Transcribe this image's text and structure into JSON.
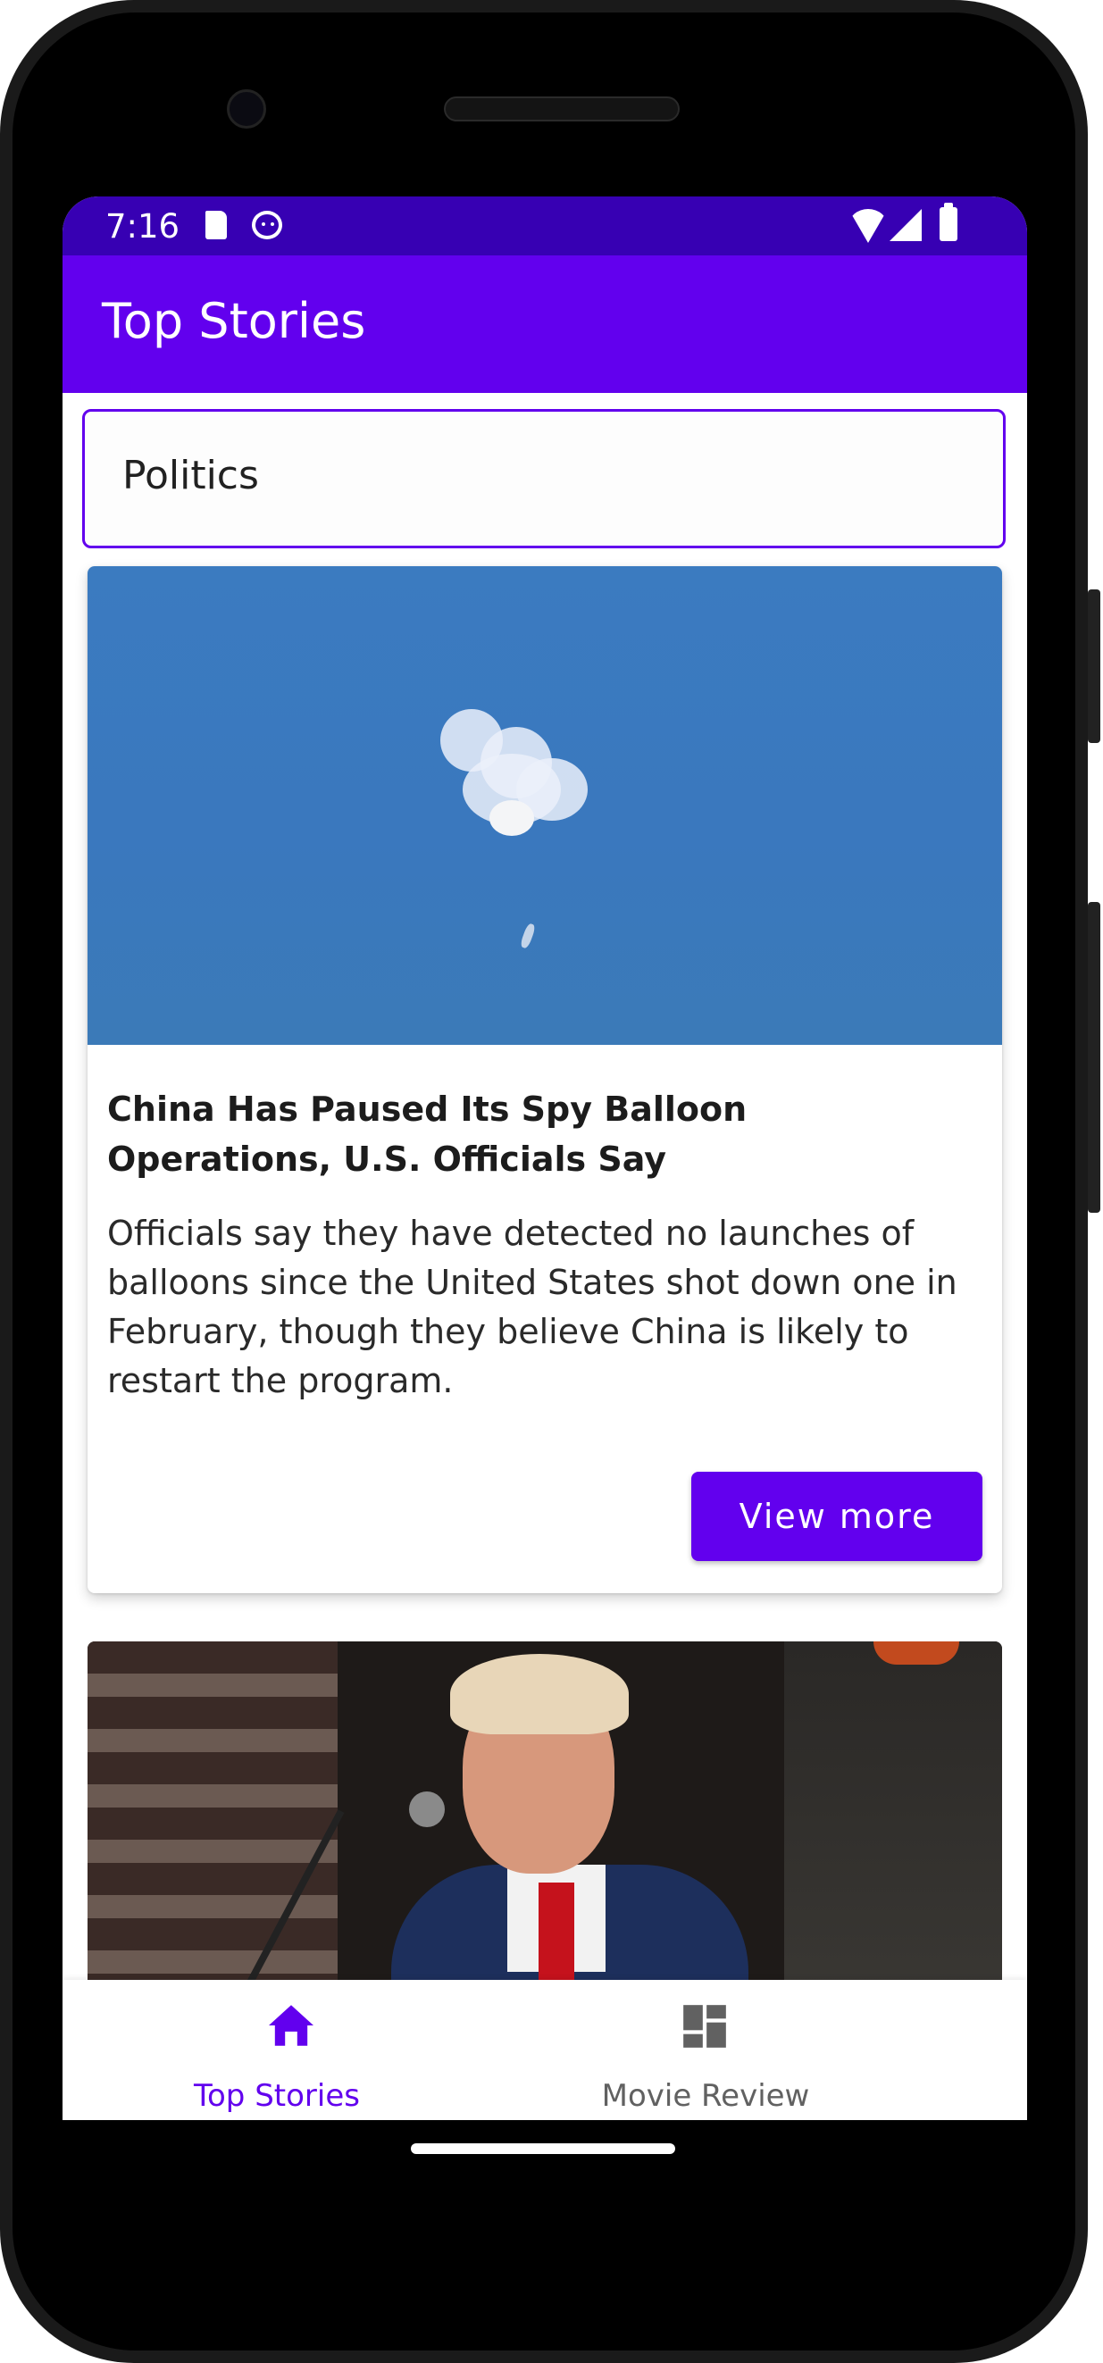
{
  "status_bar": {
    "time": "7:16"
  },
  "app_bar": {
    "title": "Top Stories"
  },
  "category_selector": {
    "value": "Politics"
  },
  "stories": [
    {
      "title": "China Has Paused Its Spy Balloon Operations, U.S. Officials Say",
      "abstract": "Officials say they have detected no launches of balloons since the United States shot down one in February, though they believe China is likely to restart the program.",
      "button_label": "View more"
    }
  ],
  "bottom_nav": {
    "items": [
      {
        "label": "Top Stories",
        "icon": "home-icon",
        "selected": true
      },
      {
        "label": "Movie Review",
        "icon": "dashboard-icon",
        "selected": false
      }
    ]
  },
  "colors": {
    "primary": "#6200ee",
    "primary_dark": "#3700b3"
  }
}
